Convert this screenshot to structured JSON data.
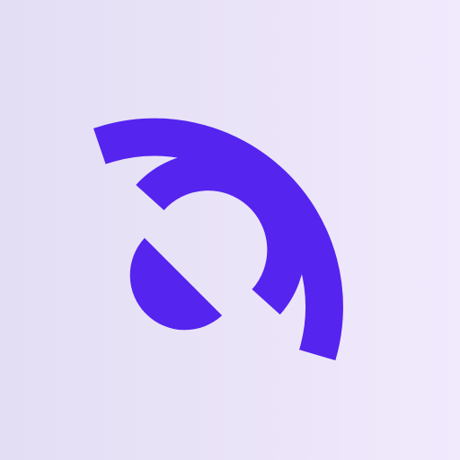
{
  "icon": {
    "name": "broadcast-signal-icon",
    "colors": {
      "background_start": "#e3def4",
      "background_end": "#f1e9fc",
      "mark": "#5524ef"
    }
  }
}
